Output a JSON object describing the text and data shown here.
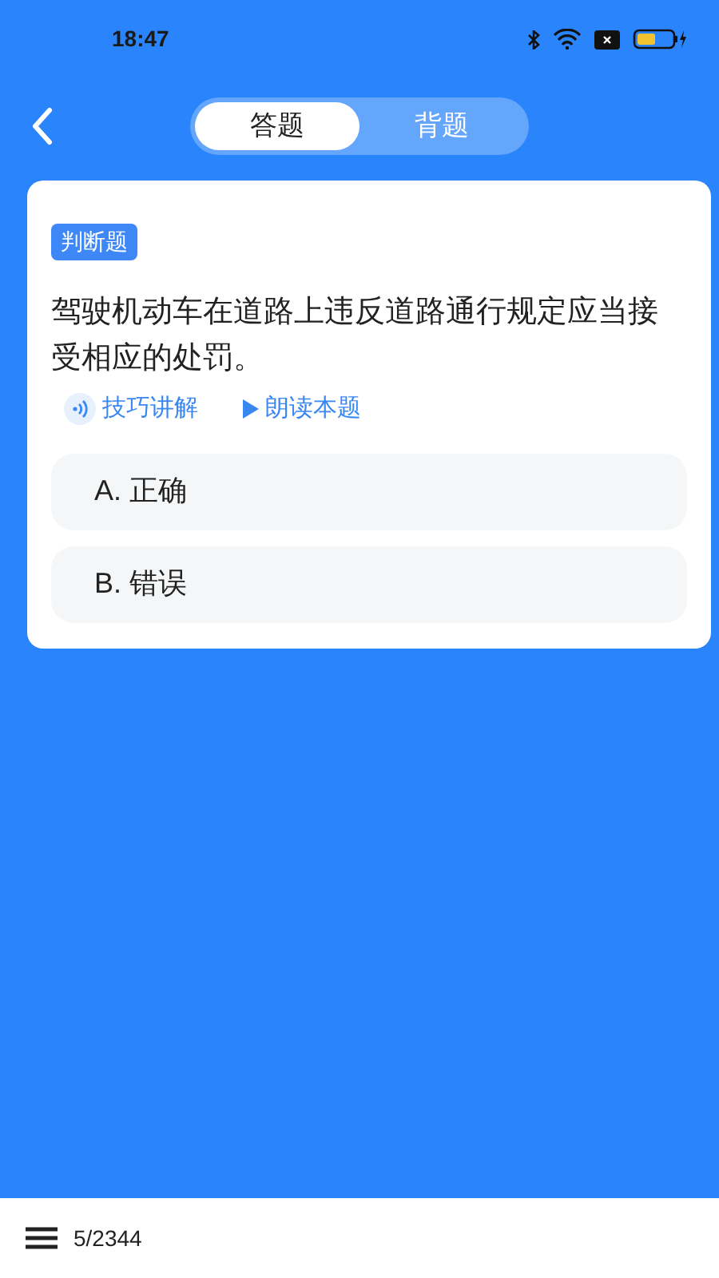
{
  "status_bar": {
    "time": "18:47"
  },
  "tabs": [
    {
      "label": "答题",
      "selected": true
    },
    {
      "label": "背题",
      "selected": false
    }
  ],
  "question": {
    "type_badge": "判断题",
    "text": "驾驶机动车在道路上违反道路通行规定应当接受相应的处罚。",
    "actions": [
      {
        "kind": "audio",
        "label": "技巧讲解"
      },
      {
        "kind": "play",
        "label": "朗读本题"
      }
    ]
  },
  "options": [
    {
      "label": "A. 正确",
      "selected": false
    },
    {
      "label": "B. 错误",
      "selected": false
    }
  ],
  "bottom_bar": {
    "progress": "5/2344"
  }
}
